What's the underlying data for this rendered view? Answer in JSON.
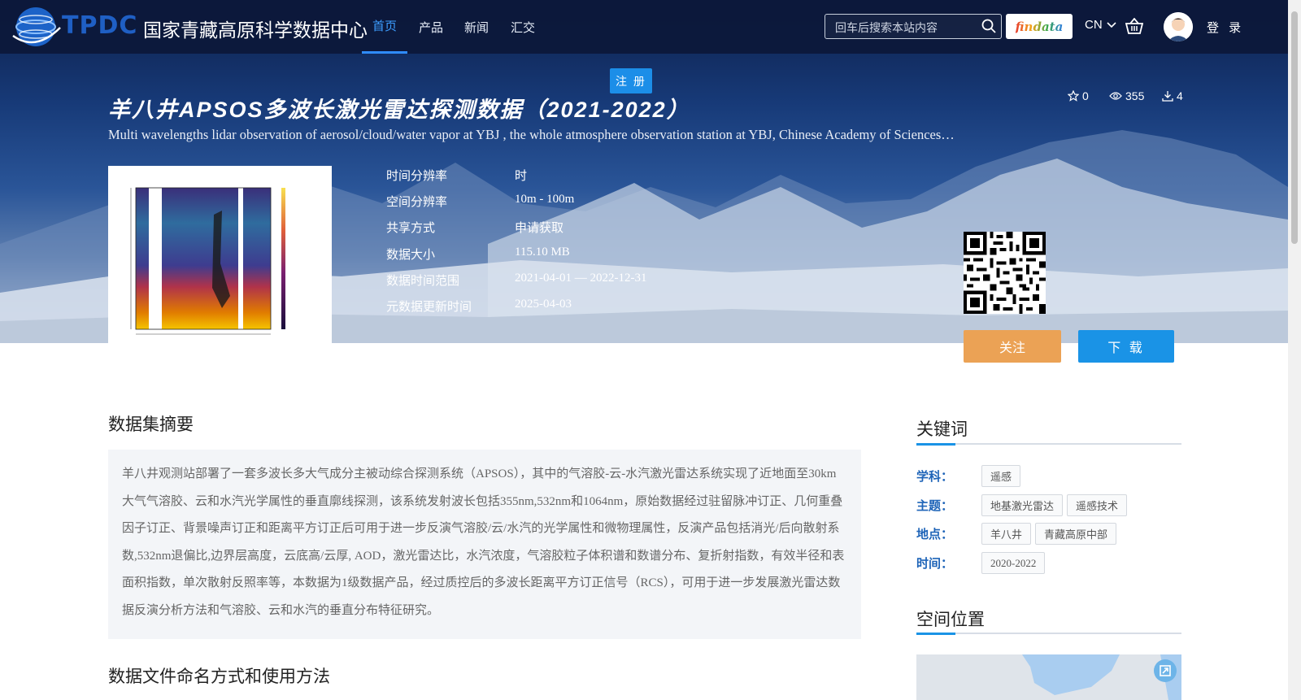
{
  "header": {
    "logo_text": "TPDC",
    "site_name": "国家青藏高原科学数据中心",
    "nav": [
      {
        "label": "首页"
      },
      {
        "label": "产品"
      },
      {
        "label": "新闻"
      },
      {
        "label": "汇交"
      }
    ],
    "search_placeholder": "回车后搜索本站内容",
    "findata_label": "findata",
    "language": "CN",
    "login_label": "登 录",
    "register_label": "注 册"
  },
  "dataset": {
    "title": "羊八井APSOS多波长激光雷达探测数据（2021-2022）",
    "subtitle": "Multi wavelengths lidar observation of aerosol/cloud/water vapor at YBJ , the whole atmosphere observation station at YBJ, Chinese Academy of Sciences…",
    "favorites": "0",
    "views": "355",
    "downloads": "4",
    "meta": [
      {
        "key": "时间分辨率",
        "value": "时"
      },
      {
        "key": "空间分辨率",
        "value": "10m - 100m"
      },
      {
        "key": "共享方式",
        "value": "申请获取"
      },
      {
        "key": "数据大小",
        "value": "115.10 MB"
      },
      {
        "key": "数据时间范围",
        "value": "2021-04-01 — 2022-12-31"
      },
      {
        "key": "元数据更新时间",
        "value": "2025-04-03"
      }
    ],
    "follow_label": "关注",
    "download_label": "下 载"
  },
  "abstract": {
    "title": "数据集摘要",
    "text": "羊八井观测站部署了一套多波长多大气成分主被动综合探测系统（APSOS），其中的气溶胶-云-水汽激光雷达系统实现了近地面至30km大气气溶胶、云和水汽光学属性的垂直廓线探测，该系统发射波长包括355nm,532nm和1064nm，原始数据经过驻留脉冲订正、几何重叠因子订正、背景噪声订正和距离平方订正后可用于进一步反演气溶胶/云/水汽的光学属性和微物理属性，反演产品包括消光/后向散射系数,532nm退偏比,边界层高度，云底高/云厚, AOD，激光雷达比，水汽浓度，气溶胶粒子体积谱和数谱分布、复折射指数，有效半径和表面积指数，单次散射反照率等，本数据为1级数据产品，经过质控后的多波长距离平方订正信号（RCS），可用于进一步发展激光雷达数据反演分析方法和气溶胶、云和水汽的垂直分布特征研究。"
  },
  "file_naming": {
    "title": "数据文件命名方式和使用方法"
  },
  "keywords": {
    "title": "关键词",
    "groups": [
      {
        "label": "学科：",
        "tags": [
          "遥感"
        ]
      },
      {
        "label": "主题：",
        "tags": [
          "地基激光雷达",
          "遥感技术"
        ]
      },
      {
        "label": "地点：",
        "tags": [
          "羊八井",
          "青藏高原中部"
        ]
      },
      {
        "label": "时间：",
        "tags": [
          "2020-2022"
        ]
      }
    ]
  },
  "spatial": {
    "title": "空间位置"
  },
  "colors": {
    "nav_active": "#3d9dff",
    "accent_blue": "#1a93e6",
    "follow_orange": "#eba255",
    "keyword_label": "#1e64b8"
  }
}
